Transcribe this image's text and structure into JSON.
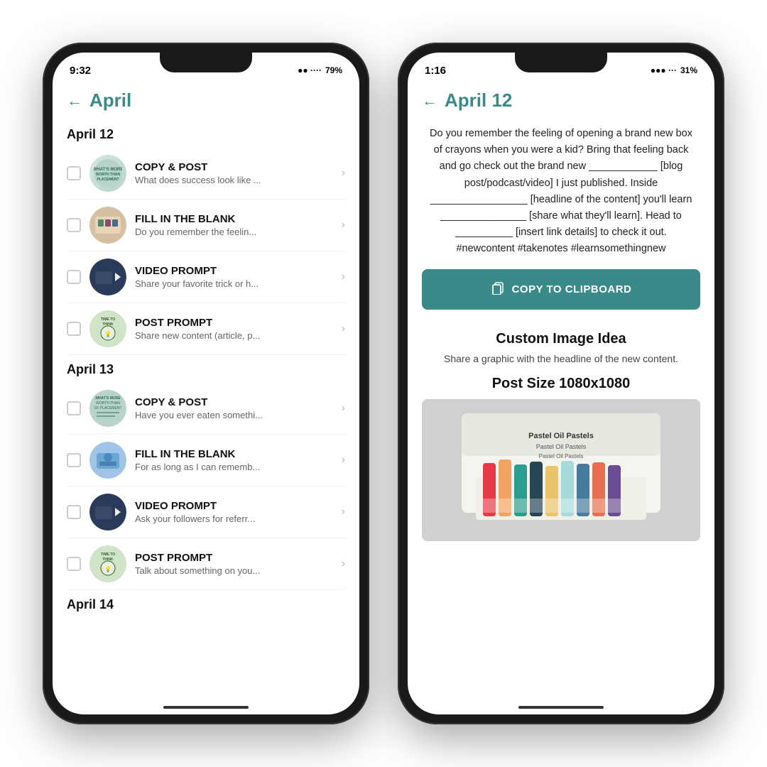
{
  "phone_left": {
    "status": {
      "time": "9:32",
      "signal": "●● ····",
      "battery": "79%"
    },
    "nav": {
      "back_label": "←",
      "title": "April"
    },
    "sections": [
      {
        "date": "April 12",
        "items": [
          {
            "type": "COPY & POST",
            "subtitle": "What does success look like ...",
            "thumb_type": "copy-post"
          },
          {
            "type": "FILL IN THE BLANK",
            "subtitle": "Do you remember the feelin...",
            "thumb_type": "fill-blank"
          },
          {
            "type": "VIDEO PROMPT",
            "subtitle": "Share your favorite trick or h...",
            "thumb_type": "video-prompt"
          },
          {
            "type": "POST PROMPT",
            "subtitle": "Share new content (article, p...",
            "thumb_type": "post-prompt"
          }
        ]
      },
      {
        "date": "April 13",
        "items": [
          {
            "type": "COPY & POST",
            "subtitle": "Have you ever eaten somethi...",
            "thumb_type": "copy-post"
          },
          {
            "type": "FILL IN THE BLANK",
            "subtitle": "For as long as I can rememb...",
            "thumb_type": "fill-blank"
          },
          {
            "type": "VIDEO PROMPT",
            "subtitle": "Ask your followers for referr...",
            "thumb_type": "video-prompt"
          },
          {
            "type": "POST PROMPT",
            "subtitle": "Talk about something on you...",
            "thumb_type": "post-prompt"
          }
        ]
      },
      {
        "date": "April 14",
        "items": []
      }
    ]
  },
  "phone_right": {
    "status": {
      "time": "1:16",
      "signal": "●●● ···",
      "battery": "31%"
    },
    "nav": {
      "back_label": "←",
      "title": "April 12"
    },
    "post_text": "Do you remember the feeling of opening a brand new box of crayons when you were a kid? Bring that feeling back and go check out the brand new ____________ [blog post/podcast/video] I just published. Inside _________________ [headline of the content] you'll learn _______________ [share what they'll learn]. Head to __________ [insert link details] to check it out. #newcontent #takenotes #learnsomethingnew",
    "copy_button_label": "COPY TO CLIPBOARD",
    "custom_image_title": "Custom Image Idea",
    "custom_image_desc": "Share a graphic with the headline of the new content.",
    "post_size_title": "Post Size 1080x1080"
  },
  "colors": {
    "teal": "#3a8a8a",
    "dark": "#111111",
    "gray": "#666666",
    "light_gray": "#f0f0f0",
    "crayon_colors": [
      "#e63946",
      "#f4a261",
      "#2a9d8f",
      "#264653",
      "#e9c46a",
      "#a8dadc",
      "#457b9d",
      "#e76f51"
    ]
  }
}
